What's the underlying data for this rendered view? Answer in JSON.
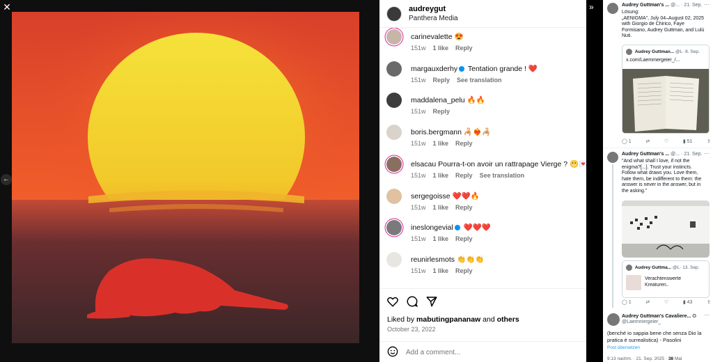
{
  "controls": {
    "close_icon": "close-icon",
    "prev_icon": "chevron-left-icon",
    "expand_icon": "double-chevron-right-icon"
  },
  "instagram": {
    "post_user": "audreygut",
    "post_subtitle": "Panthera Media",
    "comments": [
      {
        "user": "carinevalette",
        "text": "😍",
        "age": "151w",
        "likes": "1 like",
        "reply": "Reply",
        "ring": true
      },
      {
        "user": "margauxderhy",
        "verified": true,
        "text": "Tentation grande ! ❤️",
        "age": "151w",
        "reply": "Reply",
        "see_translation": "See translation",
        "ring": false
      },
      {
        "user": "maddalena_pelu",
        "text": "🔥🔥",
        "age": "151w",
        "reply": "Reply",
        "ring": false
      },
      {
        "user": "boris.bergmann",
        "text": "🦂❤️‍🔥🦂",
        "age": "151w",
        "likes": "1 like",
        "reply": "Reply",
        "ring": false
      },
      {
        "user": "elsacau",
        "text": "Pourra-t-on avoir un rattrapage Vierge ? 😬💌",
        "age": "151w",
        "likes": "1 like",
        "reply": "Reply",
        "see_translation": "See translation",
        "ring": true
      },
      {
        "user": "sergegoisse",
        "text": "❤️❤️🔥",
        "age": "151w",
        "likes": "1 like",
        "reply": "Reply",
        "ring": false
      },
      {
        "user": "ineslongevial",
        "verified": true,
        "text": "❤️❤️❤️",
        "age": "151w",
        "likes": "1 like",
        "reply": "Reply",
        "ring": true
      },
      {
        "user": "reunirlesmots",
        "text": "👏👏👏",
        "age": "151w",
        "likes": "1 like",
        "reply": "Reply",
        "ring": false
      }
    ],
    "likes_prefix": "Liked by",
    "likes_user": "mabutingpananaw",
    "likes_and": "and",
    "likes_others": "others",
    "date": "October 23, 2022",
    "comment_placeholder": "Add a comment..."
  },
  "twitter": {
    "post1": {
      "name": "Audrey Guttman's ...",
      "handle": "@...",
      "date": "· 21. Sep.",
      "lines": [
        "Lösung:",
        "„AENIGMA\", July 04–August 02, 2025",
        "with Giorgio de Chirico, Faye",
        "Formisano, Audrey Guttman, and Lulù",
        "Nuti."
      ],
      "quote_name": "Audrey Guttman...",
      "quote_handle": "@L·",
      "quote_date": "8. Sep.",
      "quote_text": "x.com/Laemmergeier_/...",
      "replies": "1",
      "views": "51"
    },
    "post2": {
      "name": "Audrey Guttman's ...",
      "handle": "@...",
      "date": "· 21. Sep.",
      "lines": [
        "\"And what shall I love, if not the",
        "enigma?[...]. Trust your instincts.",
        "Follow what draws you. Love them,",
        "hate them, be  indifferent to them: the",
        "answer is never in the answer, but in",
        "the  asking.\""
      ],
      "quote_name": "Audrey Guttma...",
      "quote_handle": "@L·",
      "quote_date": "13. Sep.",
      "quote_lines": [
        "Verachtenswerte",
        "Kreaturen.."
      ],
      "replies": "1",
      "views": "43"
    },
    "post3": {
      "name": "Audrey Guttman's Cavaliere...",
      "handle": "@Laemmergeier_",
      "lines": [
        "(benché io sappia bene che senza Dio la",
        "pratica è surrealistica) - Pasolini"
      ],
      "translate": "Post übersetzen",
      "footer_time": "9:13 nachm. · 21. Sep. 2025 ·",
      "footer_views": "38",
      "footer_suffix": "Mal"
    }
  },
  "colors": {
    "ig_blue": "#0095f6",
    "tw_blue": "#1d9bf0",
    "sun": "#f4d12a",
    "sky": "#e8452a"
  }
}
